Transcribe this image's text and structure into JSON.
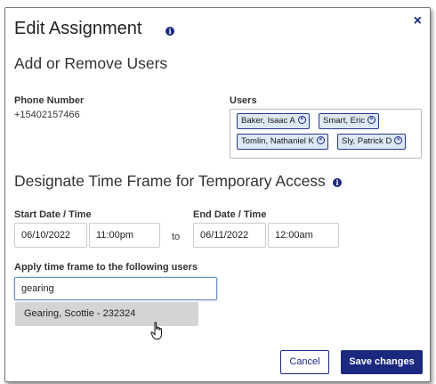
{
  "dialog": {
    "title": "Edit Assignment",
    "close_label": "×"
  },
  "add_remove": {
    "heading": "Add or Remove Users",
    "phone_label": "Phone Number",
    "phone_value": "+15402157466",
    "users_label": "Users",
    "users": [
      {
        "name": "Baker, Isaac A"
      },
      {
        "name": "Smart, Eric"
      },
      {
        "name": "Tomlin, Nathaniel K"
      },
      {
        "name": "Sly, Patrick D"
      }
    ]
  },
  "time_frame": {
    "heading": "Designate Time Frame for Temporary Access",
    "start_label": "Start Date / Time",
    "start_date": "06/10/2022",
    "start_time": "11:00pm",
    "to_label": "to",
    "end_label": "End Date / Time",
    "end_date": "06/11/2022",
    "end_time": "12:00am",
    "apply_label": "Apply time frame to the following users",
    "search_value": "gearing",
    "suggestions": [
      "Gearing, Scottie - 232324"
    ]
  },
  "footer": {
    "cancel_label": "Cancel",
    "save_label": "Save changes"
  },
  "icons": {
    "info": "info-circle-icon",
    "chip_remove": "remove-circle-icon",
    "cursor": "hand-pointer-icon"
  },
  "colors": {
    "accent": "#1b2880",
    "chip_bg": "#dce8f4",
    "suggestion_bg": "#d4d4d4"
  }
}
